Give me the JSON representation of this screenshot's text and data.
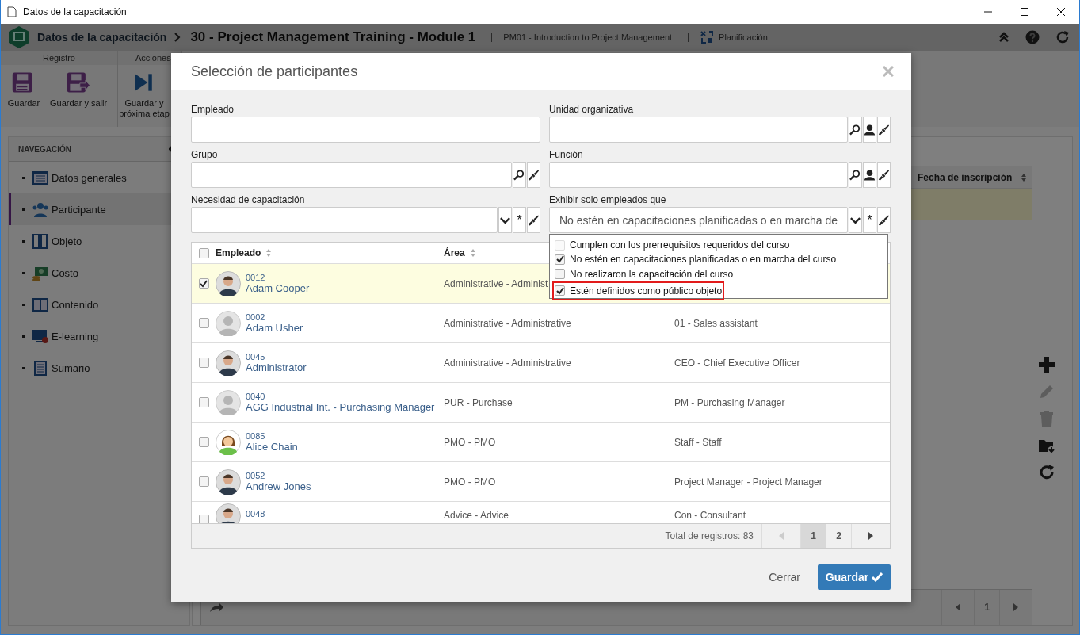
{
  "window": {
    "title": "Datos de la capacitación"
  },
  "header": {
    "app_title": "Datos de la capacitación",
    "record_title": "30 - Project Management Training - Module 1",
    "course": "PM01 - Introduction to Project Management",
    "stage": "Planificación"
  },
  "ribbon": {
    "groups": [
      {
        "label": "Registro",
        "buttons": [
          {
            "label": "Guardar"
          },
          {
            "label": "Guardar y salir"
          }
        ]
      },
      {
        "label": "Acciones",
        "buttons": [
          {
            "label": "Guardar y próxima etap"
          }
        ]
      }
    ]
  },
  "navigation": {
    "title": "NAVEGACIÓN",
    "items": [
      {
        "label": "Datos generales",
        "selected": false
      },
      {
        "label": "Participante",
        "selected": true
      },
      {
        "label": "Objeto",
        "selected": false
      },
      {
        "label": "Costo",
        "selected": false
      },
      {
        "label": "Contenido",
        "selected": false
      },
      {
        "label": "E-learning",
        "selected": false
      },
      {
        "label": "Sumario",
        "selected": false
      }
    ]
  },
  "participants_panel": {
    "columns": [
      "Fecha de inscripción"
    ],
    "toolbar": [
      {
        "disabled": false
      },
      {
        "disabled": true
      },
      {
        "disabled": true
      },
      {
        "disabled": false
      },
      {
        "disabled": false
      }
    ],
    "pages": [
      {
        "label": "1"
      }
    ]
  },
  "dialog": {
    "title": "Selección de participantes",
    "fields": [
      {
        "label": "Empleado",
        "kind": "text"
      },
      {
        "label": "Unidad organizativa",
        "kind": "text"
      },
      {
        "label": "Grupo",
        "kind": "text"
      },
      {
        "label": "Función",
        "kind": "text"
      },
      {
        "label": "Necesidad de capacitación",
        "kind": "select",
        "asterisk": "*"
      },
      {
        "label": "Exhibir solo empleados que",
        "kind": "select",
        "value": "No estén en capacitaciones planificadas o en marcha de",
        "asterisk": "*"
      }
    ],
    "filter_options": [
      {
        "label": "Cumplen con los prerrequisitos requeridos del curso",
        "checked": false,
        "disabled": true,
        "highlighted": false
      },
      {
        "label": "No estén en capacitaciones planificadas o en marcha del curso",
        "checked": true,
        "disabled": false,
        "highlighted": false
      },
      {
        "label": "No realizaron la capacitación del curso",
        "checked": false,
        "disabled": false,
        "highlighted": false
      },
      {
        "label": "Estén definidos como público objeto",
        "checked": true,
        "disabled": false,
        "highlighted": true
      }
    ],
    "table": {
      "all_checked": false,
      "columns": [
        "Empleado",
        "Área"
      ],
      "rows": [
        {
          "code": "0012",
          "name": "Adam Cooper",
          "area": "Administrative - Administ",
          "checked": true,
          "selected": true,
          "kind": "photo"
        },
        {
          "code": "0002",
          "name": "Adam Usher",
          "area": "Administrative - Administrative",
          "function": "01 - Sales assistant",
          "checked": false,
          "selected": false,
          "kind": "placeholder"
        },
        {
          "code": "0045",
          "name": "Administrator",
          "area": "Administrative - Administrative",
          "function": "CEO - Chief Executive Officer",
          "checked": false,
          "selected": false,
          "kind": "photo"
        },
        {
          "code": "0040",
          "name": "AGG Industrial Int. - Purchasing Manager",
          "area": "PUR - Purchase",
          "function": "PM - Purchasing Manager",
          "checked": false,
          "selected": false,
          "kind": "placeholder"
        },
        {
          "code": "0085",
          "name": "Alice Chain",
          "area": "PMO - PMO",
          "function": "Staff - Staff",
          "checked": false,
          "selected": false,
          "kind": "cartoon"
        },
        {
          "code": "0052",
          "name": "Andrew Jones",
          "area": "PMO - PMO",
          "function": "Project Manager - Project Manager",
          "checked": false,
          "selected": false,
          "kind": "photo"
        },
        {
          "code": "0048",
          "area": "Advice - Advice",
          "function": "Con - Consultant",
          "checked": false,
          "selected": false,
          "kind": "photo"
        }
      ]
    },
    "total": "Total de registros: 83",
    "pages": [
      {
        "label": "1",
        "selected": true
      },
      {
        "label": "2",
        "selected": false
      }
    ],
    "cancel": "Cerrar",
    "confirm": "Guardar"
  }
}
